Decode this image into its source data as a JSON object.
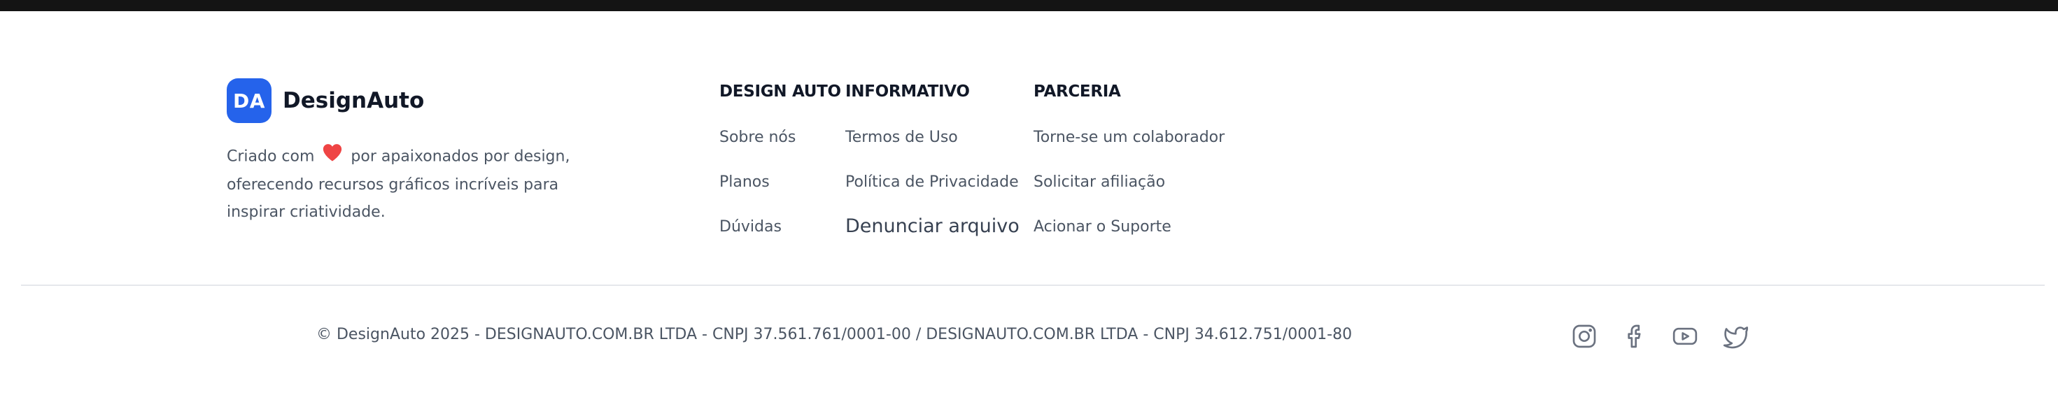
{
  "brand": {
    "badge": "DA",
    "name": "DesignAuto",
    "badge_color": "#2563eb",
    "desc_before": "Criado com",
    "desc_after": "por apaixonados por design, oferecendo recursos gráficos incríveis para inspirar criatividade.",
    "heart_icon": "heart-icon",
    "heart_color": "#ef4444"
  },
  "columns": [
    {
      "title": "DESIGN AUTO",
      "links": [
        "Sobre nós",
        "Planos",
        "Dúvidas"
      ]
    },
    {
      "title": "INFORMATIVO",
      "links": [
        "Termos de Uso",
        "Política de Privacidade",
        "Denunciar arquivo"
      ]
    },
    {
      "title": "PARCERIA",
      "links": [
        "Torne-se um colaborador",
        "Solicitar afiliação",
        "Acionar o Suporte"
      ]
    }
  ],
  "footer": {
    "copyright": "© DesignAuto 2025 - DESIGNAUTO.COM.BR LTDA - CNPJ 37.561.761/0001-00 / DESIGNAUTO.COM.BR LTDA - CNPJ 34.612.751/0001-80"
  },
  "social": [
    "instagram-icon",
    "facebook-icon",
    "youtube-icon",
    "twitter-icon"
  ],
  "colors": {
    "topbar": "#141414",
    "text_muted": "#4b5563",
    "heading": "#111827",
    "divider": "#e5e7eb"
  }
}
